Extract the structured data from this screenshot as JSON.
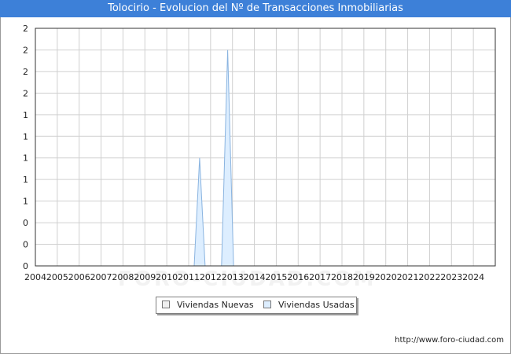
{
  "title": "Tolocirio - Evolucion del Nº de Transacciones Inmobiliarias",
  "source": "http://www.foro-ciudad.com",
  "watermark": "FORO-CIUDAD.COM",
  "colors": {
    "title_bg": "#3d80d8",
    "nuevas_fill": "#f0f0f0",
    "usadas_fill": "#ddeeff",
    "usadas_stroke": "#8ab4e0",
    "grid": "#d0d0d0"
  },
  "chart_data": {
    "type": "area",
    "title": "Tolocirio - Evolucion del Nº de Transacciones Inmobiliarias",
    "x_tick_labels": [
      "2004",
      "2005",
      "2006",
      "2007",
      "2008",
      "2009",
      "2010",
      "2011",
      "2012",
      "2013",
      "2014",
      "2015",
      "2016",
      "2017",
      "2018",
      "2019",
      "2020",
      "2021",
      "2022",
      "2023",
      "2024"
    ],
    "y_tick_labels": [
      "0",
      "0",
      "0",
      "1",
      "1",
      "1",
      "1",
      "1",
      "2",
      "2",
      "2",
      "2"
    ],
    "xlim": [
      2004,
      2025
    ],
    "ylim": [
      0,
      2.2
    ],
    "grid": true,
    "legend_position": "bottom-center",
    "series": [
      {
        "name": "Viviendas Nuevas",
        "color": "#f0f0f0",
        "points": [
          [
            2004,
            0
          ],
          [
            2025,
            0
          ]
        ]
      },
      {
        "name": "Viviendas Usadas",
        "color": "#ddeeff",
        "points": [
          [
            2004,
            0
          ],
          [
            2011.25,
            0
          ],
          [
            2011.5,
            1
          ],
          [
            2011.75,
            0
          ],
          [
            2012.5,
            0
          ],
          [
            2012.78,
            2
          ],
          [
            2013.05,
            0
          ],
          [
            2025,
            0
          ]
        ]
      }
    ]
  }
}
